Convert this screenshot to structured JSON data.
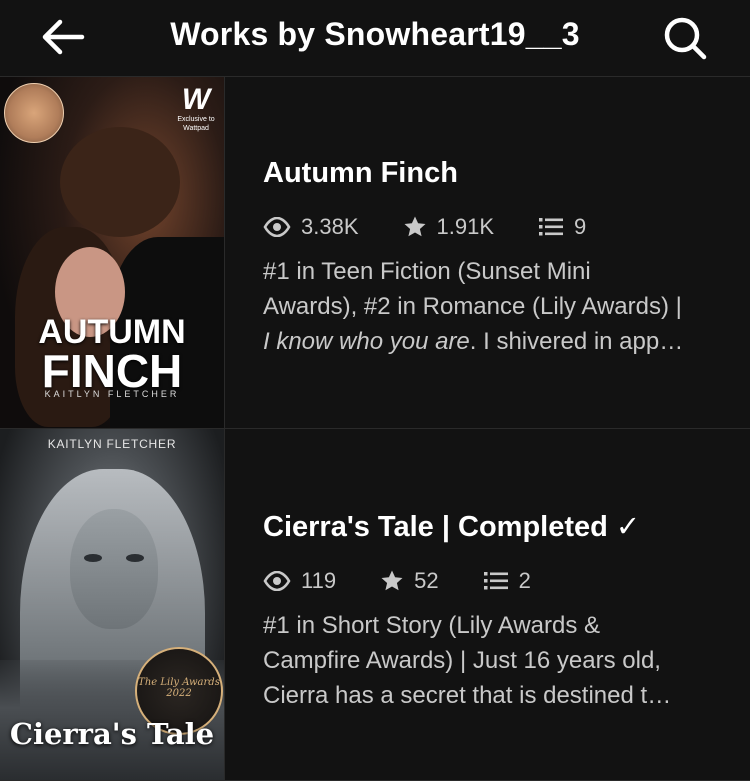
{
  "header": {
    "title": "Works by Snowheart19__3",
    "back_icon": "arrow-left-icon",
    "search_icon": "search-icon"
  },
  "works": [
    {
      "title": "Autumn Finch",
      "reads": "3.38K",
      "votes": "1.91K",
      "parts": "9",
      "description_lines": [
        "#1 in Teen Fiction (Sunset Mini",
        "Awards), #2 in Romance (Lily Awards) |",
        "I know who you are. I shivered in app…"
      ],
      "cover": {
        "title_line1": "AUTUMN",
        "title_line2": "FINCH",
        "author": "KAITLYN FLETCHER",
        "logo": "W",
        "logo_text": "Exclusive to Wattpad"
      }
    },
    {
      "title": "Cierra's Tale | Completed ✓",
      "reads": "119",
      "votes": "52",
      "parts": "2",
      "description_lines": [
        "#1 in Short Story (Lily Awards &",
        "Campfire Awards)  | Just 16 years old,",
        "Cierra has a secret that is destined t…"
      ],
      "cover": {
        "author": "KAITLYN FLETCHER",
        "title": "Cierra's Tale",
        "badge": "The Lily Awards 2022"
      }
    }
  ],
  "colors": {
    "background": "#121212",
    "text": "#ffffff",
    "muted": "#c9c9c9",
    "divider": "#2a2a2a"
  }
}
